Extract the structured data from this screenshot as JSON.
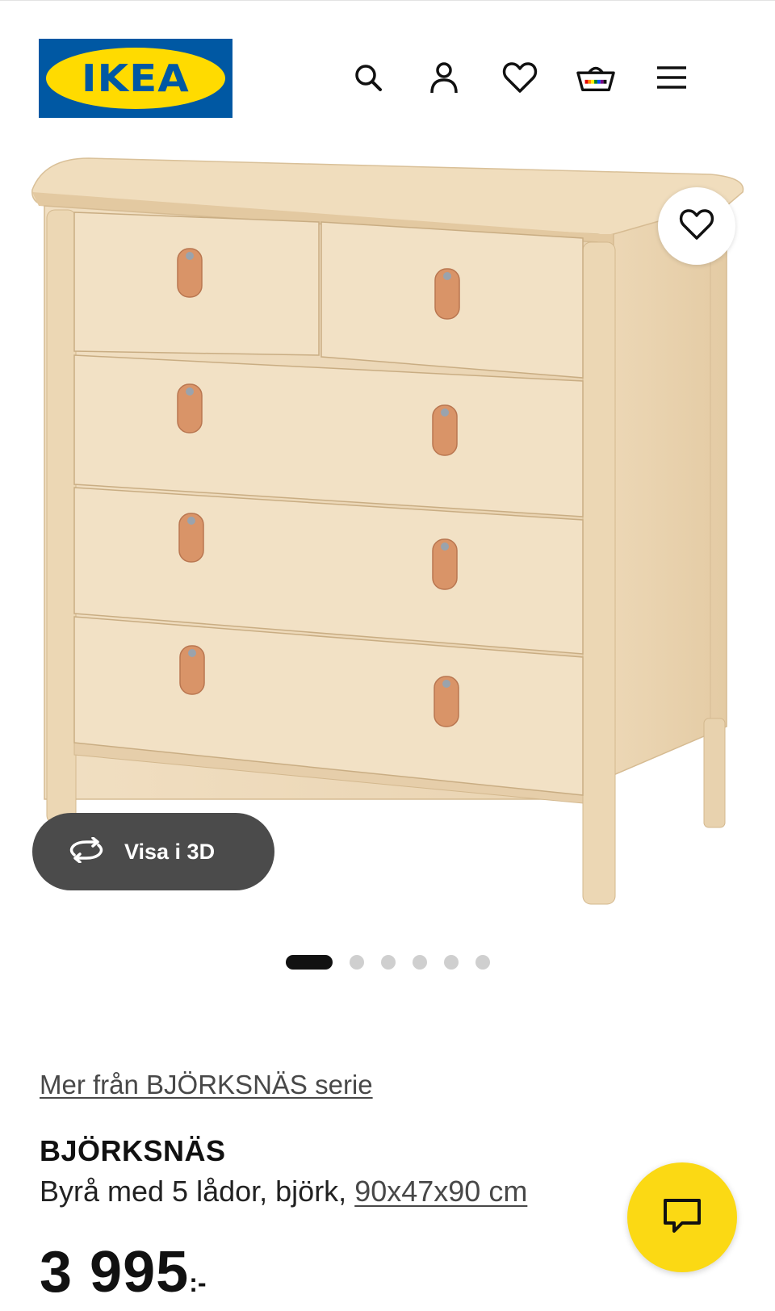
{
  "header": {
    "logo_text": "IKEA",
    "logo_colors": {
      "background": "#0058a3",
      "oval": "#ffdb00"
    },
    "icons": [
      "search-icon",
      "account-icon",
      "wishlist-heart-icon",
      "cart-icon",
      "menu-icon"
    ]
  },
  "gallery": {
    "view_3d_label": "Visa i 3D",
    "dot_count": 6,
    "active_dot": 1
  },
  "product": {
    "series_link": "Mer från BJÖRKSNÄS serie",
    "name": "BJÖRKSNÄS",
    "description": "Byrå med 5 lådor, björk,",
    "dimensions": "90x47x90 cm",
    "price": "3 995",
    "price_suffix": ":-"
  },
  "colors": {
    "accent_yellow": "#fbd914",
    "dark_button": "#4b4b4b",
    "text": "#111111"
  }
}
